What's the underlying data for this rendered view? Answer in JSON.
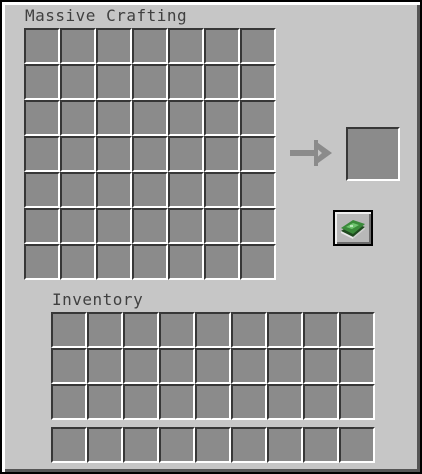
{
  "window": {
    "title": "Massive Crafting",
    "inventory_label": "Inventory"
  },
  "crafting_grid": {
    "columns": 7,
    "rows": 7
  },
  "inventory_grid": {
    "columns": 9,
    "rows": 3
  },
  "hotbar": {
    "columns": 9
  },
  "icons": {
    "arrow": "arrow-right-icon",
    "recipe_button": "recipe-book-icon"
  },
  "colors": {
    "panel": "#c6c6c6",
    "slot": "#8b8b8b",
    "arrow": "#8b8b8b",
    "book_green": "#3a8a3a",
    "book_pages": "#e8e8e8"
  }
}
